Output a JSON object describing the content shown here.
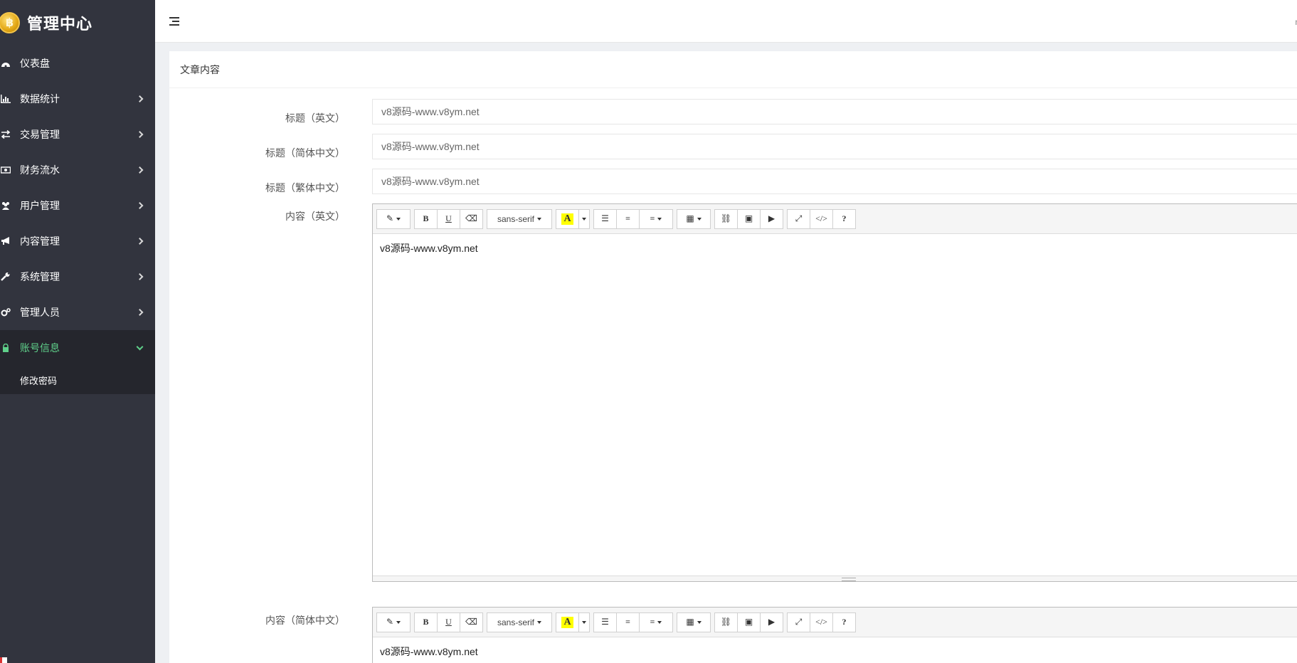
{
  "app": {
    "title": "管理中心"
  },
  "sidebar": {
    "items": [
      {
        "label": "仪表盘",
        "icon": "dashboard-icon",
        "has_children": false
      },
      {
        "label": "数据统计",
        "icon": "bar-chart-icon",
        "has_children": true
      },
      {
        "label": "交易管理",
        "icon": "exchange-icon",
        "has_children": true
      },
      {
        "label": "财务流水",
        "icon": "money-icon",
        "has_children": true
      },
      {
        "label": "用户管理",
        "icon": "users-icon",
        "has_children": true
      },
      {
        "label": "内容管理",
        "icon": "bullhorn-icon",
        "has_children": true
      },
      {
        "label": "系统管理",
        "icon": "wrench-icon",
        "has_children": true
      },
      {
        "label": "管理人员",
        "icon": "gears-icon",
        "has_children": true
      },
      {
        "label": "账号信息",
        "icon": "lock-icon",
        "has_children": true,
        "expanded": true
      }
    ],
    "sub_items": [
      {
        "label": "修改密码"
      }
    ]
  },
  "panel": {
    "title": "文章内容",
    "fields": [
      {
        "label": "标题（英文）",
        "value": "v8源码-www.v8ym.net"
      },
      {
        "label": "标题（简体中文）",
        "value": "v8源码-www.v8ym.net"
      },
      {
        "label": "标题（繁体中文）",
        "value": "v8源码-www.v8ym.net"
      }
    ],
    "editors": [
      {
        "label": "内容（英文）",
        "content": "v8源码-www.v8ym.net"
      },
      {
        "label": "内容（简体中文）",
        "content": "v8源码-www.v8ym.net"
      }
    ]
  },
  "toolbar": {
    "bold": "B",
    "underline": "U",
    "font_family": "sans-serif",
    "color_letter": "A",
    "code": "</>",
    "help": "?"
  },
  "colors": {
    "sidebar_bg": "#32343e",
    "active_text": "#5fd08a",
    "highlight": "#ffff00"
  }
}
